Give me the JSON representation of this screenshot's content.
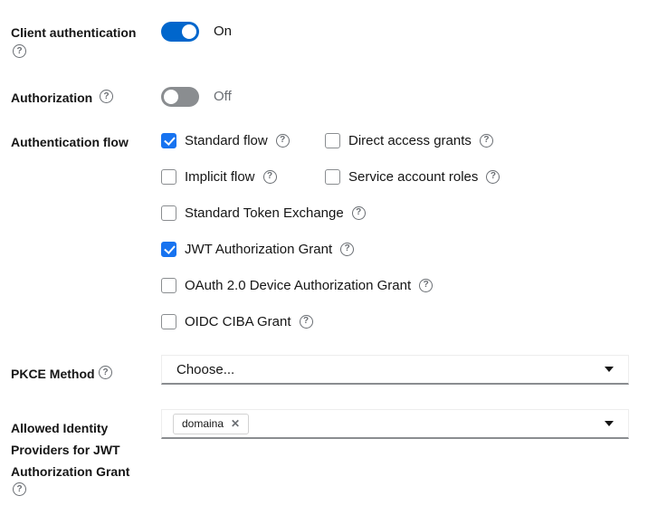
{
  "icons": {
    "help": "?",
    "close": "✕"
  },
  "colors": {
    "toggle_on": "#0066cc",
    "toggle_off": "#8a8d90",
    "checkbox_checked": "#1773f0",
    "text": "#151515",
    "muted_text": "#6a6e73",
    "input_border": "#ededed",
    "input_border_bottom": "#8a8d90",
    "chip_border": "#d2d2d2"
  },
  "form": {
    "client_authentication": {
      "label": "Client authentication",
      "state": "On",
      "on": true
    },
    "authorization": {
      "label": "Authorization",
      "state": "Off",
      "on": false
    },
    "authentication_flow": {
      "label": "Authentication flow",
      "options": [
        {
          "label": "Standard flow",
          "checked": true
        },
        {
          "label": "Direct access grants",
          "checked": false
        },
        {
          "label": "Implicit flow",
          "checked": false
        },
        {
          "label": "Service account roles",
          "checked": false
        },
        {
          "label": "Standard Token Exchange",
          "checked": false
        },
        {
          "label": "JWT Authorization Grant",
          "checked": true
        },
        {
          "label": "OAuth 2.0 Device Authorization Grant",
          "checked": false
        },
        {
          "label": "OIDC CIBA Grant",
          "checked": false
        }
      ]
    },
    "pkce_method": {
      "label": "PKCE Method",
      "selected": "Choose..."
    },
    "allowed_identity_providers": {
      "label": "Allowed Identity Providers for JWT Authorization Grant",
      "chips": [
        "domaina"
      ]
    }
  }
}
